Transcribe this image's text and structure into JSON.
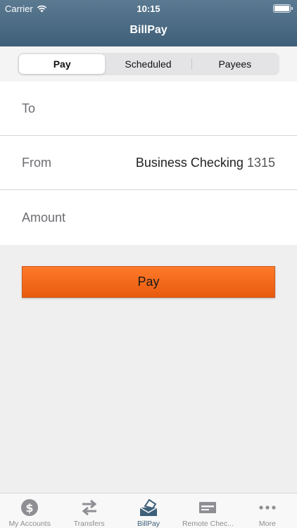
{
  "status_bar": {
    "carrier": "Carrier",
    "time": "10:15"
  },
  "nav": {
    "title": "BillPay"
  },
  "segments": [
    {
      "label": "Pay",
      "active": true
    },
    {
      "label": "Scheduled",
      "active": false
    },
    {
      "label": "Payees",
      "active": false
    }
  ],
  "form": {
    "to_label": "To",
    "from_label": "From",
    "from_account": "Business Checking",
    "from_account_number": "1315",
    "amount_label": "Amount"
  },
  "pay_button": "Pay",
  "tabs": [
    {
      "label": "My Accounts",
      "icon": "dollar-circle-icon"
    },
    {
      "label": "Transfers",
      "icon": "transfer-arrows-icon"
    },
    {
      "label": "BillPay",
      "icon": "billpay-envelope-icon",
      "active": true
    },
    {
      "label": "Remote Chec...",
      "icon": "check-card-icon"
    },
    {
      "label": "More",
      "icon": "more-dots-icon"
    }
  ],
  "colors": {
    "nav": "#4a6a82",
    "accent": "#f26a1f",
    "tab_active": "#3e5f79"
  }
}
